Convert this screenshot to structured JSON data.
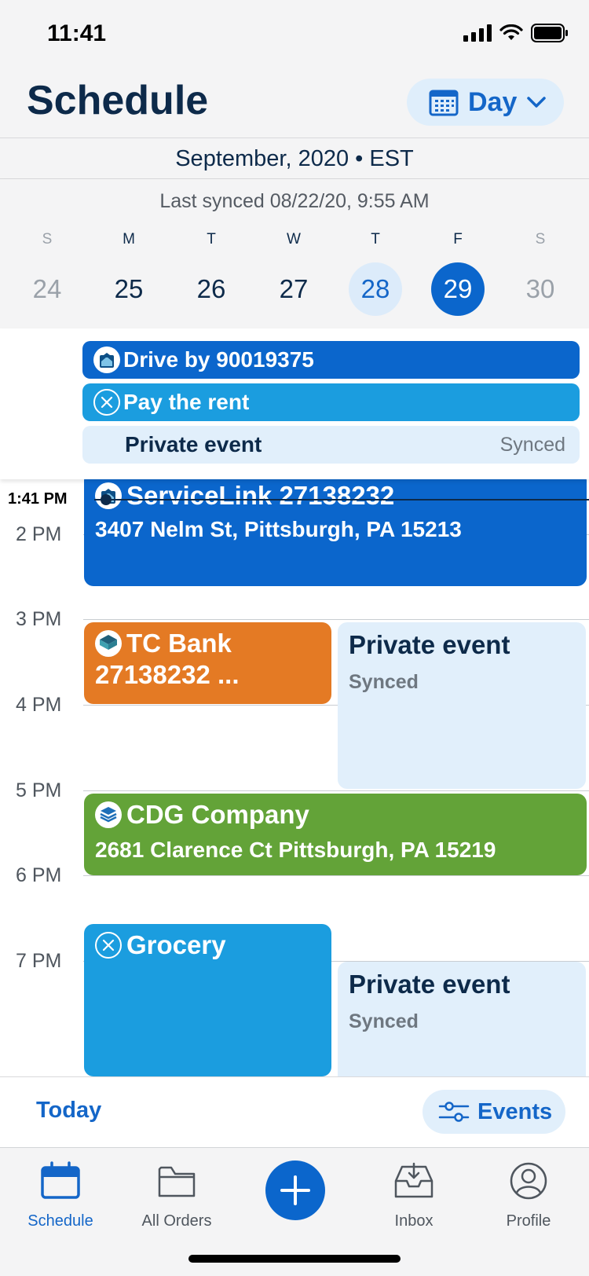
{
  "status_bar": {
    "time": "11:41"
  },
  "header": {
    "title": "Schedule",
    "view_mode": "Day"
  },
  "month_label": "September, 2020 • EST",
  "sync_status": "Last synced 08/22/20, 9:55 AM",
  "week": [
    {
      "dow": "S",
      "num": "24"
    },
    {
      "dow": "M",
      "num": "25"
    },
    {
      "dow": "T",
      "num": "26"
    },
    {
      "dow": "W",
      "num": "27"
    },
    {
      "dow": "T",
      "num": "28"
    },
    {
      "dow": "F",
      "num": "29"
    },
    {
      "dow": "S",
      "num": "30"
    }
  ],
  "all_day_events": [
    {
      "title": "Drive by 90019375",
      "color": "#0b66cc"
    },
    {
      "title": "Pay the rent",
      "color": "#1b9ddf"
    },
    {
      "title": "Private event",
      "tag": "Synced"
    }
  ],
  "timeline": {
    "current_time": "1:41 PM",
    "hours": [
      "2 PM",
      "3 PM",
      "4 PM",
      "5 PM",
      "6 PM",
      "7 PM"
    ],
    "events": [
      {
        "title": "ServiceLink 27138232",
        "subtitle": "3407 Nelm St, Pittsburgh, PA 15213",
        "color": "#0b66cc"
      },
      {
        "title": "TC Bank",
        "subtitle": "27138232 ...",
        "color": "#e47a24"
      },
      {
        "title": "Private event",
        "subtitle": "Synced"
      },
      {
        "title": "CDG Company",
        "subtitle": "2681 Clarence Ct Pittsburgh, PA 15219",
        "color": "#63a338"
      },
      {
        "title": "Grocery",
        "color": "#1b9ddf"
      },
      {
        "title": "Private event",
        "subtitle": "Synced"
      }
    ]
  },
  "footer": {
    "today": "Today",
    "events": "Events"
  },
  "tabs": [
    {
      "label": "Schedule",
      "icon": "calendar-icon"
    },
    {
      "label": "All Orders",
      "icon": "folder-icon"
    },
    {
      "label": "",
      "icon": "plus-icon"
    },
    {
      "label": "Inbox",
      "icon": "inbox-icon"
    },
    {
      "label": "Profile",
      "icon": "profile-icon"
    }
  ],
  "colors": {
    "accent": "#1466c8",
    "dark": "#0d2a4a",
    "private_bg": "#e1effb"
  }
}
